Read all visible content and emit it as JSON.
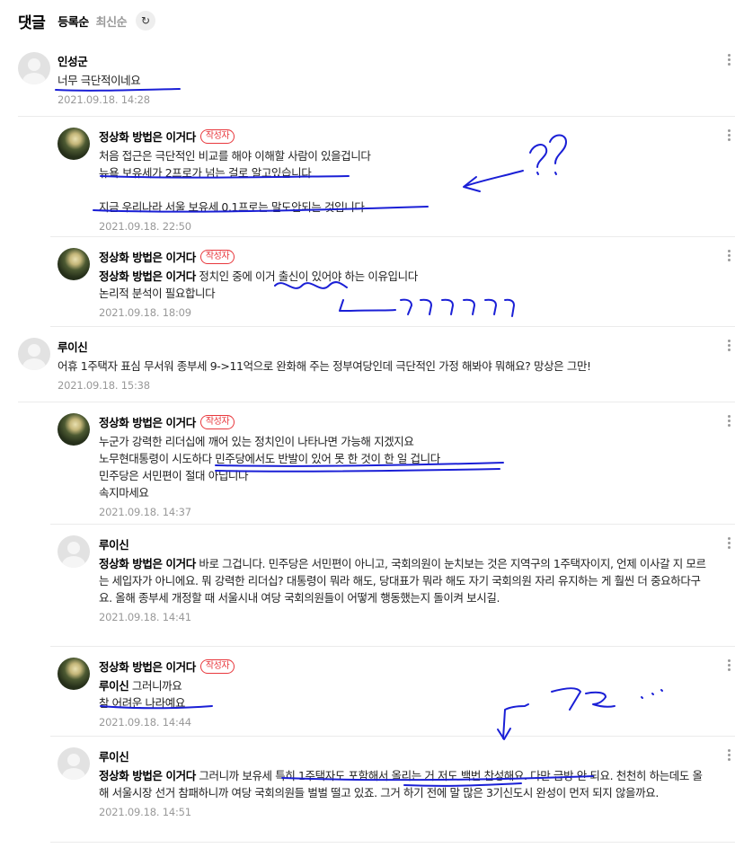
{
  "header": {
    "title": "댓글",
    "sort_active": "등록순",
    "sort_inactive": "최신순",
    "refresh_icon": "↻"
  },
  "author_badge": "작성자",
  "comments": [
    {
      "nick": "인성군",
      "text": "너무 극단적이네요",
      "date": "2021.09.18. 14:28",
      "avatar": "default"
    },
    {
      "nick": "정상화 방법은 이거다",
      "text": "처음 접근은 극단적인 비교를 해야 이해할 사람이 있을겁니다\n뉴욕 보유세가 2프로가 넘는 걸로 알고있습니다\n\n지금 우리나라 서울 보유세 0.1프로는 말도안되는 것입니다",
      "date": "2021.09.18. 22:50",
      "avatar": "photo"
    },
    {
      "nick": "정상화 방법은 이거다",
      "mention": "정상화 방법은 이거다",
      "text": " 정치인 중에 이거 출신이 있어야 하는 이유입니다\n논리적 분석이 필요합니다",
      "date": "2021.09.18. 18:09",
      "avatar": "photo"
    },
    {
      "nick": "루이신",
      "text": "어휴 1주택자 표심 무서워 종부세 9->11억으로 완화해 주는 정부여당인데 극단적인 가정 해봐야 뭐해요? 망상은 그만!",
      "date": "2021.09.18. 15:38",
      "avatar": "default"
    },
    {
      "nick": "정상화 방법은 이거다",
      "text": "누군가 강력한 리더십에 깨어 있는 정치인이 나타나면 가능해 지겠지요\n노무현대통령이 시도하다 민주당에서도 반발이 있어 못 한 것이 한 일 겁니다\n민주당은 서민편이 절대 아닙니다\n속지마세요",
      "date": "2021.09.18. 14:37",
      "avatar": "photo"
    },
    {
      "nick": "루이신",
      "mention": "정상화 방법은 이거다",
      "text": " 바로 그겁니다. 민주당은 서민편이 아니고, 국회의원이 눈치보는 것은 지역구의 1주택자이지, 언제 이사갈 지 모르는 세입자가 아니에요. 뭐 강력한 리더십? 대통령이 뭐라 해도, 당대표가 뭐라 해도 자기 국회의원 자리 유지하는 게 훨씬 더 중요하다구요. 올해 종부세 개정할 때 서울시내 여당 국회의원들이 어떻게 행동했는지 돌이켜 보시길.",
      "date": "2021.09.18. 14:41",
      "avatar": "default"
    },
    {
      "nick": "정상화 방법은 이거다",
      "mention": "루이신",
      "text": " 그러니까요\n참 어려운 나라예요",
      "date": "2021.09.18. 14:44",
      "avatar": "photo"
    },
    {
      "nick": "루이신",
      "mention": "정상화 방법은 이거다",
      "text": " 그러니까 보유세 특히 1주택자도 포함해서 올리는 거 저도 백번 찬성해요. 다만 급방 안 되요. 천천히 하는데도 올해 서울시장 선거 참패하니까 여당 국회의원들 벌벌 떨고 있죠. 그거 하기 전에 말 많은 3기신도시 완성이 먼저 되지 않을까요.",
      "date": "2021.09.18. 14:51",
      "avatar": "default"
    }
  ],
  "annotations": {
    "question_marks": "??",
    "laugh": "ㅋㅋㅋㅋㅋ",
    "eyes": "ㄱㄹ..."
  }
}
